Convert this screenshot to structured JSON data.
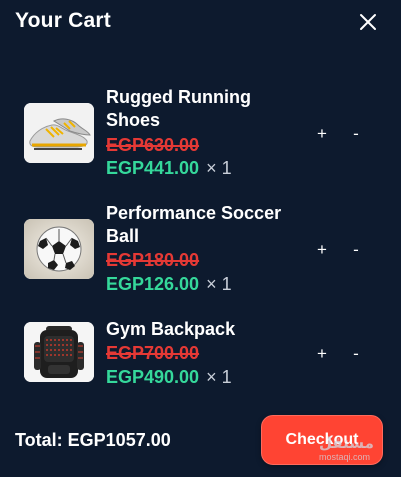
{
  "cart": {
    "title": "Your Cart",
    "close_icon": "close-icon"
  },
  "items": [
    {
      "name": "Rugged Running Shoes",
      "original_price": "EGP630.00",
      "sale_price": "EGP441.00",
      "quantity": "× 1",
      "image_icon": "running-shoe-icon",
      "plus_label": "+",
      "minus_label": "-"
    },
    {
      "name": "Performance Soccer Ball",
      "original_price": "EGP180.00",
      "sale_price": "EGP126.00",
      "quantity": "× 1",
      "image_icon": "soccer-ball-icon",
      "plus_label": "+",
      "minus_label": "-"
    },
    {
      "name": "Gym Backpack",
      "original_price": "EGP700.00",
      "sale_price": "EGP490.00",
      "quantity": "× 1",
      "image_icon": "backpack-icon",
      "plus_label": "+",
      "minus_label": "-"
    }
  ],
  "footer": {
    "total": "Total: EGP1057.00",
    "checkout_label": "Checkout"
  },
  "watermark": {
    "arabic": "مستقل",
    "latin": "mostaqi.com"
  },
  "colors": {
    "background": "#0d1a2e",
    "sale_price": "#35d89b",
    "original_price": "#e53935",
    "checkout": "#ff4433"
  }
}
